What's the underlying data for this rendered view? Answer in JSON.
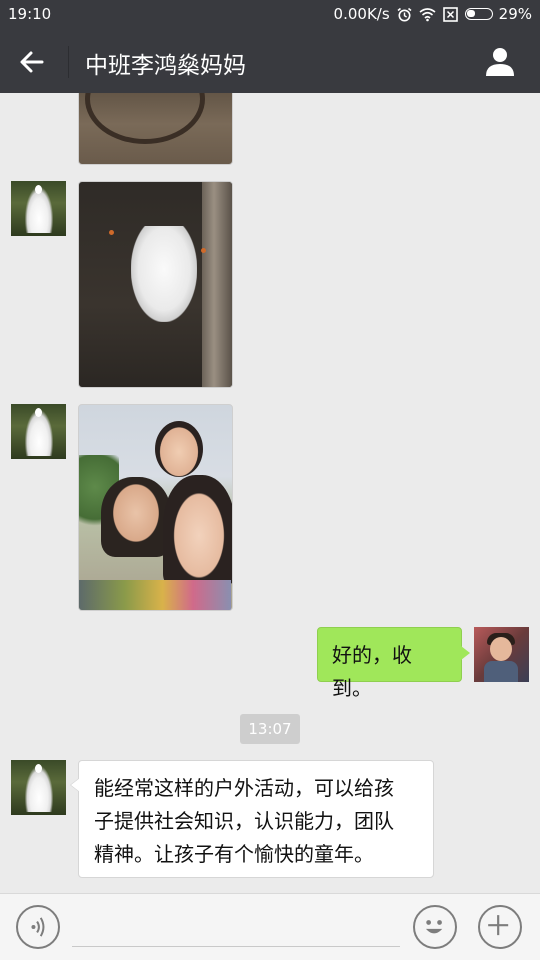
{
  "status_bar": {
    "time": "19:10",
    "network_speed": "0.00K/s",
    "battery": "29%",
    "icons": [
      "alarm-icon",
      "wifi-icon",
      "sim-icon",
      "battery-icon"
    ]
  },
  "header": {
    "title": "中班李鸿燊妈妈",
    "back_icon": "arrow-left-icon",
    "profile_icon": "person-icon"
  },
  "messages": [
    {
      "type": "image",
      "side": "left",
      "content": "photo"
    },
    {
      "type": "image",
      "side": "left",
      "content": "photo"
    },
    {
      "type": "image",
      "side": "left",
      "content": "photo"
    },
    {
      "type": "text",
      "side": "right",
      "text": "好的，收到。"
    },
    {
      "type": "timestamp",
      "text": "13:07"
    },
    {
      "type": "text",
      "side": "left",
      "lines": [
        "能经常这样的户外活动，可以给孩",
        "子提供社会知识，认识能力，团队",
        "精神。让孩子有个愉快的童年。"
      ]
    }
  ],
  "input_bar": {
    "voice_icon": "voice-icon",
    "emoji_icon": "emoji-icon",
    "plus_icon": "plus-icon"
  },
  "colors": {
    "header_bg": "#393a3f",
    "chat_bg": "#ebebeb",
    "bubble_sent": "#a0e75a",
    "bubble_received": "#ffffff"
  }
}
